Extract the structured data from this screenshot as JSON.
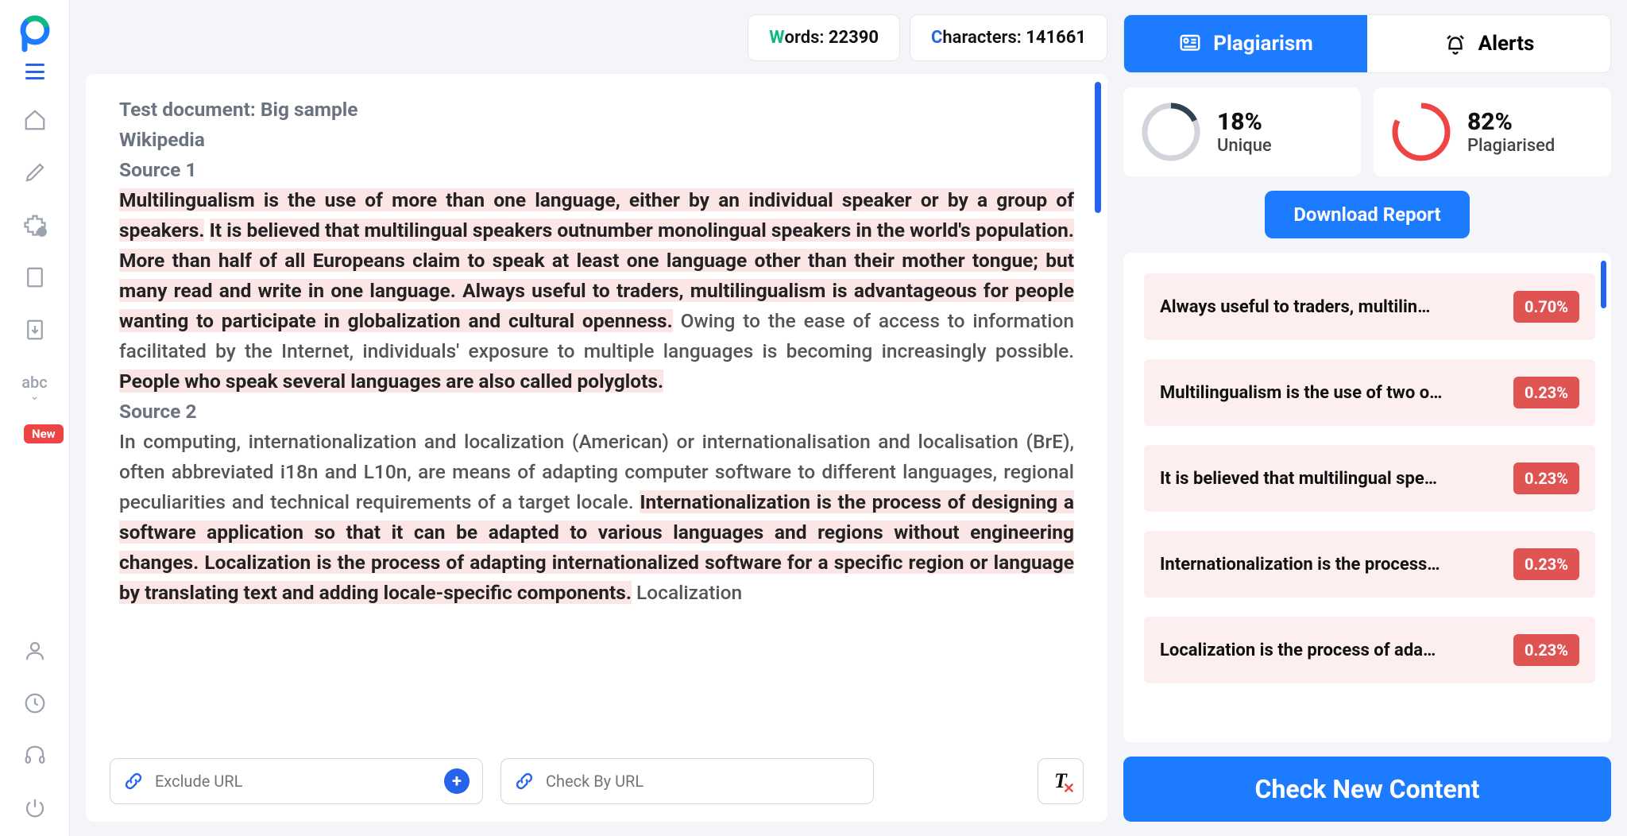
{
  "stats": {
    "words_label": "ords:",
    "words": "22390",
    "chars_label": "haracters:",
    "chars": "141661"
  },
  "doc": {
    "title": "Test document: Big sample",
    "subtitle": "Wikipedia",
    "source1_label": "Source 1",
    "s1_p1": "Multilingualism is the use of more than one language, either by an individual speaker or by a group of speakers.",
    "s1_p2": "It is believed that multilingual speakers outnumber monolingual speakers in the world's population.",
    "s1_p3": "More than half of all Europeans claim to speak at least one language other than their mother tongue; but many read and write in one language. Always useful to traders, multilingualism is advantageous for people wanting to participate in globalization and cultural openness.",
    "s1_p4": " Owing to the ease of access to information facilitated by the Internet, individuals' exposure to multiple languages is becoming increasingly possible. ",
    "s1_p5": "People who speak several languages are also called polyglots.",
    "source2_label": "Source 2",
    "s2_p1": "In computing, internationalization and localization (American) or internationalisation and localisation (BrE), often abbreviated i18n and L10n, are means of adapting computer software to different languages, regional peculiarities and technical requirements of a target locale. ",
    "s2_p2": "Internationalization is the process of designing a software application so that it can be adapted to various languages and regions without engineering changes. Localization is the process of adapting internationalized software for a specific region or language by translating text and adding locale-specific components.",
    "s2_p3": " Localization"
  },
  "footer": {
    "exclude_placeholder": "Exclude URL",
    "check_placeholder": "Check By URL"
  },
  "tabs": {
    "plagiarism": "Plagiarism",
    "alerts": "Alerts"
  },
  "gauges": {
    "unique_pct": "18%",
    "unique_label": "Unique",
    "plag_pct": "82%",
    "plag_label": "Plagiarised"
  },
  "download_label": "Download Report",
  "results": [
    {
      "text": "Always useful to traders, multilin…",
      "pct": "0.70%"
    },
    {
      "text": "Multilingualism is the use of two o…",
      "pct": "0.23%"
    },
    {
      "text": "It is believed that multilingual spe…",
      "pct": "0.23%"
    },
    {
      "text": "Internationalization is the process…",
      "pct": "0.23%"
    },
    {
      "text": "Localization is the process of ada…",
      "pct": "0.23%"
    }
  ],
  "check_label": "Check New Content",
  "new_badge": "New"
}
